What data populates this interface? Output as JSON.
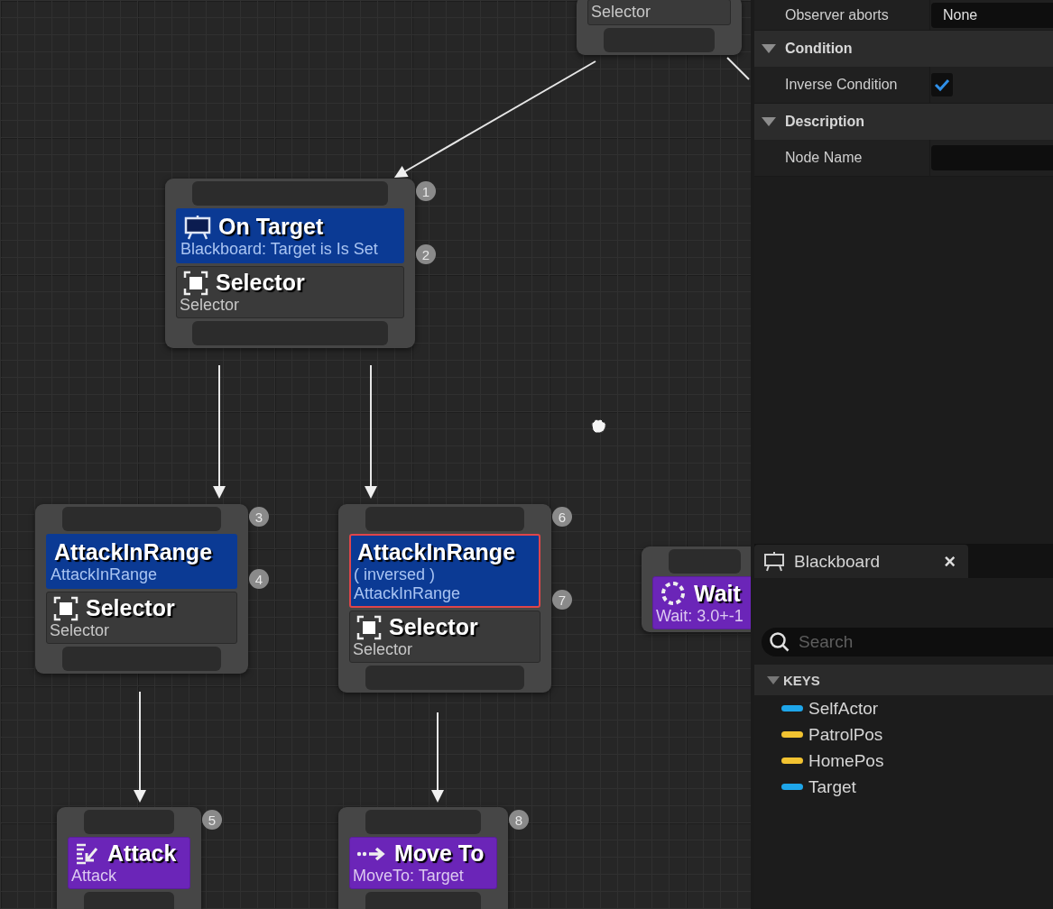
{
  "graph": {
    "nodes": [
      {
        "main": {
          "kind": "composite",
          "subtitle": "Selector"
        }
      },
      {
        "badge": "1",
        "decorators": [
          {
            "title": "On Target",
            "lines": [
              "Blackboard: Target is Is Set"
            ],
            "badge": "2",
            "selected": false
          }
        ],
        "main": {
          "kind": "composite",
          "title": "Selector",
          "subtitle": "Selector"
        }
      },
      {
        "badge": "3",
        "decorators": [
          {
            "title": "AttackInRange",
            "lines": [
              "AttackInRange"
            ],
            "badge": "4",
            "selected": false
          }
        ],
        "main": {
          "kind": "composite",
          "title": "Selector",
          "subtitle": "Selector"
        }
      },
      {
        "badge": "6",
        "decorators": [
          {
            "title": "AttackInRange",
            "lines": [
              "( inversed )",
              "AttackInRange"
            ],
            "badge": "7",
            "selected": true
          }
        ],
        "main": {
          "kind": "composite",
          "title": "Selector",
          "subtitle": "Selector"
        }
      },
      {
        "main": {
          "kind": "task",
          "title": "Wait",
          "subtitle": "Wait: 3.0+-1"
        }
      },
      {
        "badge": "5",
        "main": {
          "kind": "task",
          "title": "Attack",
          "subtitle": "Attack"
        }
      },
      {
        "badge": "8",
        "main": {
          "kind": "task",
          "title": "Move To",
          "subtitle": "MoveTo: Target"
        }
      }
    ]
  },
  "details": {
    "rows": [
      {
        "kind": "property",
        "label": "Observer aborts",
        "value": "None"
      },
      {
        "kind": "category",
        "label": "Condition",
        "expanded": true
      },
      {
        "kind": "checkbox",
        "label": "Inverse Condition",
        "checked": true
      },
      {
        "kind": "category",
        "label": "Description",
        "expanded": true
      },
      {
        "kind": "field",
        "label": "Node Name"
      }
    ]
  },
  "blackboard": {
    "tab": {
      "title": "Blackboard",
      "close": "×"
    },
    "search": {
      "placeholder": "Search"
    },
    "section": {
      "label": "KEYS",
      "expanded": true
    },
    "keys": [
      {
        "name": "SelfActor",
        "color": "#1ea6ea"
      },
      {
        "name": "PatrolPos",
        "color": "#f2c331"
      },
      {
        "name": "HomePos",
        "color": "#f2c331"
      },
      {
        "name": "Target",
        "color": "#1ea6ea"
      }
    ]
  }
}
